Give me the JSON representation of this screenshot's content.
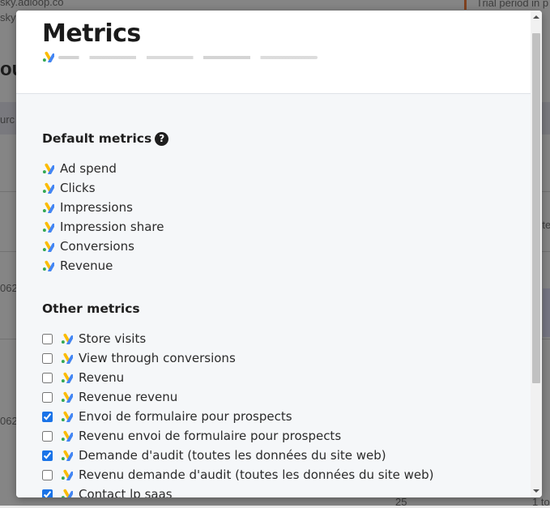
{
  "background": {
    "url_fragment_1": "sky.adloop.co",
    "url_fragment_2": "sky",
    "trial_text": "Trial period in p",
    "text_ou": "ou",
    "text_urc": "urc",
    "num_1": "062",
    "num_2": "062",
    "text_te": "(te",
    "page_size": "25",
    "text_1to": "1 to"
  },
  "modal": {
    "title": "Metrics",
    "default_metrics": {
      "heading": "Default metrics",
      "help_icon": "question-circle-icon",
      "items": [
        {
          "label": "Ad spend",
          "icon": "google-ads-icon"
        },
        {
          "label": "Clicks",
          "icon": "google-ads-icon"
        },
        {
          "label": "Impressions",
          "icon": "google-ads-icon"
        },
        {
          "label": "Impression share",
          "icon": "google-ads-icon"
        },
        {
          "label": "Conversions",
          "icon": "google-ads-icon"
        },
        {
          "label": "Revenue",
          "icon": "google-ads-icon"
        }
      ]
    },
    "other_metrics": {
      "heading": "Other metrics",
      "items": [
        {
          "label": "Store visits",
          "checked": false
        },
        {
          "label": "View through conversions",
          "checked": false
        },
        {
          "label": "Revenu",
          "checked": false
        },
        {
          "label": "Revenue revenu",
          "checked": false
        },
        {
          "label": "Envoi de formulaire pour prospects",
          "checked": true
        },
        {
          "label": "Revenu envoi de formulaire pour prospects",
          "checked": false
        },
        {
          "label": "Demande d'audit (toutes les données du site web)",
          "checked": true
        },
        {
          "label": "Revenu demande d'audit (toutes les données du site web)",
          "checked": false
        },
        {
          "label": "Contact lp saas",
          "checked": true
        }
      ]
    }
  },
  "colors": {
    "ads_blue": "#4285F4",
    "ads_yellow": "#FBBC04",
    "ads_green": "#34A853",
    "checkbox_accent": "#1a73e8"
  }
}
